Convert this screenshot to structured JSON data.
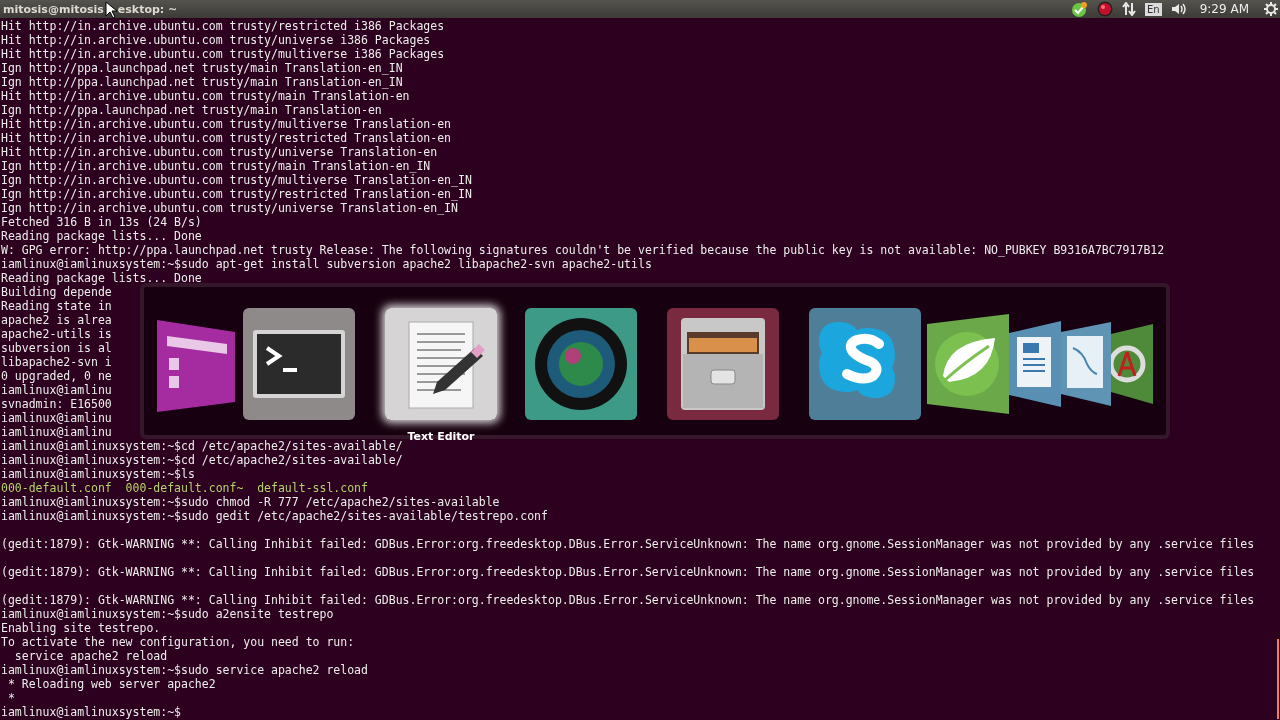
{
  "top_panel": {
    "title_parts": [
      "mitosis@mitosis",
      "esktop: ~"
    ],
    "keyboard_layout": "En",
    "clock": "9:29 AM"
  },
  "terminal": {
    "lines": [
      {
        "kind": "output",
        "text": "Hit http://in.archive.ubuntu.com trusty/restricted i386 Packages"
      },
      {
        "kind": "output",
        "text": "Hit http://in.archive.ubuntu.com trusty/universe i386 Packages"
      },
      {
        "kind": "output",
        "text": "Hit http://in.archive.ubuntu.com trusty/multiverse i386 Packages"
      },
      {
        "kind": "output",
        "text": "Ign http://ppa.launchpad.net trusty/main Translation-en_IN"
      },
      {
        "kind": "output",
        "text": "Ign http://ppa.launchpad.net trusty/main Translation-en_IN"
      },
      {
        "kind": "output",
        "text": "Hit http://in.archive.ubuntu.com trusty/main Translation-en"
      },
      {
        "kind": "output",
        "text": "Ign http://ppa.launchpad.net trusty/main Translation-en"
      },
      {
        "kind": "output",
        "text": "Hit http://in.archive.ubuntu.com trusty/multiverse Translation-en"
      },
      {
        "kind": "output",
        "text": "Hit http://in.archive.ubuntu.com trusty/restricted Translation-en"
      },
      {
        "kind": "output",
        "text": "Hit http://in.archive.ubuntu.com trusty/universe Translation-en"
      },
      {
        "kind": "output",
        "text": "Ign http://in.archive.ubuntu.com trusty/main Translation-en_IN"
      },
      {
        "kind": "output",
        "text": "Ign http://in.archive.ubuntu.com trusty/multiverse Translation-en_IN"
      },
      {
        "kind": "output",
        "text": "Ign http://in.archive.ubuntu.com trusty/restricted Translation-en_IN"
      },
      {
        "kind": "output",
        "text": "Ign http://in.archive.ubuntu.com trusty/universe Translation-en_IN"
      },
      {
        "kind": "output",
        "text": "Fetched 316 B in 13s (24 B/s)"
      },
      {
        "kind": "output",
        "text": "Reading package lists... Done"
      },
      {
        "kind": "output",
        "text": "W: GPG error: http://ppa.launchpad.net trusty Release: The following signatures couldn't be verified because the public key is not available: NO_PUBKEY B9316A7BC7917B12"
      },
      {
        "kind": "prompt",
        "text": "iamlinux@iamlinuxsystem:~$sudo apt-get install subversion apache2 libapache2-svn apache2-utils"
      },
      {
        "kind": "output",
        "text": "Reading package lists... Done"
      },
      {
        "kind": "output",
        "text": "Building depende"
      },
      {
        "kind": "output",
        "text": "Reading state in"
      },
      {
        "kind": "output",
        "text": "apache2 is alrea"
      },
      {
        "kind": "output",
        "text": "apache2-utils is"
      },
      {
        "kind": "output",
        "text": "subversion is al"
      },
      {
        "kind": "output",
        "text": "libapache2-svn i"
      },
      {
        "kind": "output",
        "text": "0 upgraded, 0 ne"
      },
      {
        "kind": "prompt",
        "text": "iamlinux@iamlinu"
      },
      {
        "kind": "output",
        "text": "svnadmin: E16500"
      },
      {
        "kind": "prompt",
        "text": "iamlinux@iamlinu"
      },
      {
        "kind": "prompt",
        "text": "iamlinux@iamlinu"
      },
      {
        "kind": "prompt",
        "text": "iamlinux@iamlinuxsystem:~$cd /etc/apache2/sites-available/"
      },
      {
        "kind": "prompt",
        "text": "iamlinux@iamlinuxsystem:~$cd /etc/apache2/sites-available/"
      },
      {
        "kind": "prompt",
        "text": "iamlinux@iamlinuxsystem:~$ls"
      },
      {
        "kind": "listing",
        "text": "000-default.conf  000-default.conf~  default-ssl.conf"
      },
      {
        "kind": "prompt",
        "text": "iamlinux@iamlinuxsystem:~$sudo chmod -R 777 /etc/apache2/sites-available"
      },
      {
        "kind": "prompt",
        "text": "iamlinux@iamlinuxsystem:~$sudo gedit /etc/apache2/sites-available/testrepo.conf"
      },
      {
        "kind": "blank"
      },
      {
        "kind": "output",
        "text": "(gedit:1879): Gtk-WARNING **: Calling Inhibit failed: GDBus.Error:org.freedesktop.DBus.Error.ServiceUnknown: The name org.gnome.SessionManager was not provided by any .service files"
      },
      {
        "kind": "blank"
      },
      {
        "kind": "output",
        "text": "(gedit:1879): Gtk-WARNING **: Calling Inhibit failed: GDBus.Error:org.freedesktop.DBus.Error.ServiceUnknown: The name org.gnome.SessionManager was not provided by any .service files"
      },
      {
        "kind": "blank"
      },
      {
        "kind": "output",
        "text": "(gedit:1879): Gtk-WARNING **: Calling Inhibit failed: GDBus.Error:org.freedesktop.DBus.Error.ServiceUnknown: The name org.gnome.SessionManager was not provided by any .service files"
      },
      {
        "kind": "prompt",
        "text": "iamlinux@iamlinuxsystem:~$sudo a2ensite testrepo"
      },
      {
        "kind": "output",
        "text": "Enabling site testrepo."
      },
      {
        "kind": "output",
        "text": "To activate the new configuration, you need to run:"
      },
      {
        "kind": "output",
        "text": "  service apache2 reload"
      },
      {
        "kind": "prompt",
        "text": "iamlinux@iamlinuxsystem:~$sudo service apache2 reload"
      },
      {
        "kind": "output",
        "text": " * Reloading web server apache2"
      },
      {
        "kind": "output",
        "text": " *"
      },
      {
        "kind": "prompt",
        "text": "iamlinux@iamlinuxsystem:~$"
      }
    ]
  },
  "app_switcher": {
    "items": [
      {
        "kind": "files",
        "selected": false
      },
      {
        "kind": "terminal",
        "selected": false
      },
      {
        "kind": "text-editor",
        "selected": true,
        "label": "Text Editor"
      },
      {
        "kind": "camera",
        "selected": false
      },
      {
        "kind": "cabinet",
        "selected": false
      },
      {
        "kind": "chat",
        "selected": false
      },
      {
        "kind": "leaf",
        "selected": false
      },
      {
        "kind": "document",
        "selected": false
      },
      {
        "kind": "workbench",
        "selected": false
      },
      {
        "kind": "update",
        "selected": false
      }
    ]
  }
}
